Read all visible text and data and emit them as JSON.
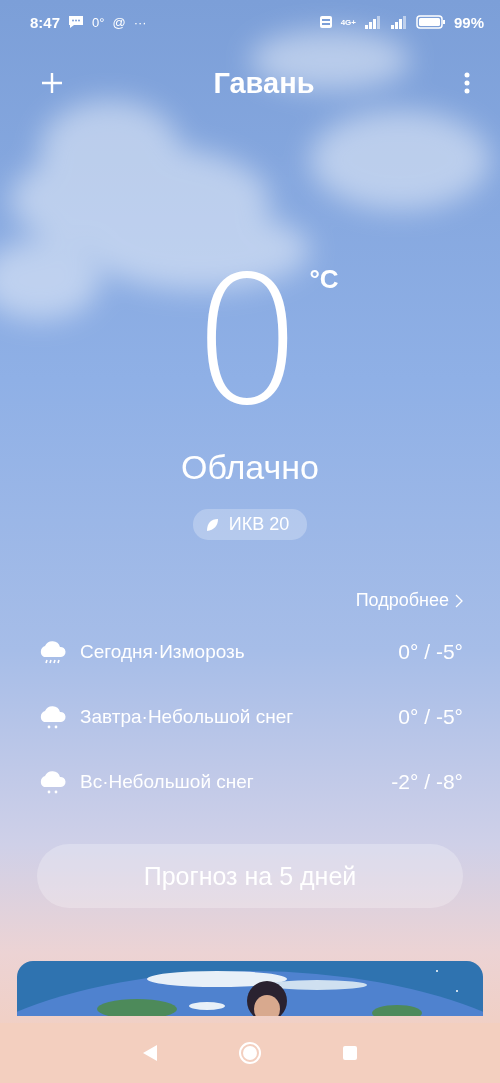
{
  "status_bar": {
    "time": "8:47",
    "notification_temp": "0°",
    "notification_mail": "@",
    "more": "···",
    "network": "4G+",
    "battery": "99%"
  },
  "header": {
    "city": "Гавань"
  },
  "current": {
    "temperature": "0",
    "unit": "°C",
    "condition": "Облачно",
    "aqi": "ИКВ 20"
  },
  "details_link": "Подробнее",
  "forecast": [
    {
      "kind": "sleet",
      "label": "Сегодня·Изморозь",
      "temps": "0° / -5°"
    },
    {
      "kind": "snow",
      "label": "Завтра·Небольшой снег",
      "temps": "0° / -5°"
    },
    {
      "kind": "snow",
      "label": "Вс·Небольшой снег",
      "temps": "-2° / -8°"
    }
  ],
  "forecast_button": "Прогноз на 5 дней"
}
